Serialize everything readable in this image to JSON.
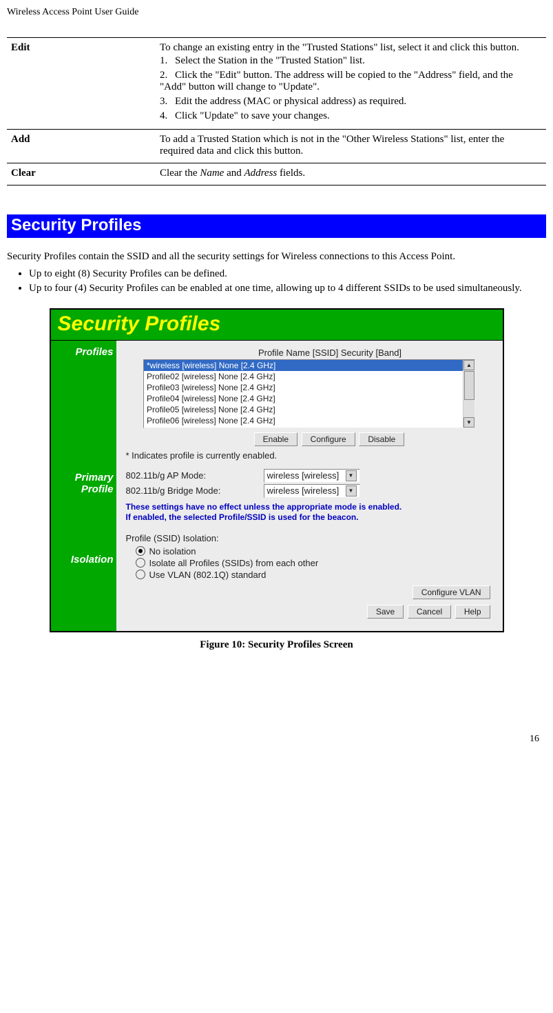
{
  "header": "Wireless Access Point User Guide",
  "pageNumber": "16",
  "table": {
    "rows": [
      {
        "name": "Edit",
        "intro": "To change an existing entry in the \"Trusted Stations\" list, select it and click this button.",
        "steps": [
          "Select the Station in the \"Trusted Station\" list.",
          "Click the \"Edit\" button. The address will be copied to the \"Address\" field, and the \"Add\" button will change to \"Update\".",
          "Edit the address (MAC or physical address) as required.",
          "Click \"Update\" to save your changes."
        ]
      },
      {
        "name": "Add",
        "desc": "To add a Trusted Station which is not in the \"Other Wireless Stations\" list, enter the required data and click this button."
      },
      {
        "name": "Clear",
        "descPrefix": "Clear the ",
        "descItalic1": "Name",
        "descMid": " and ",
        "descItalic2": "Address",
        "descSuffix": " fields."
      }
    ]
  },
  "sectionTitle": "Security Profiles",
  "intro": "Security Profiles contain the SSID and all the security settings for Wireless connections to this Access Point.",
  "bullets": [
    "Up to eight (8) Security Profiles can be defined.",
    "Up to four (4) Security Profiles can be enabled at one time, allowing up to 4 different SSIDs to be used simultaneously."
  ],
  "screenshot": {
    "title": "Security Profiles",
    "side": {
      "profiles": "Profiles",
      "primary1": "Primary",
      "primary2": "Profile",
      "isolation": "Isolation"
    },
    "columnsHeader": "Profile Name [SSID] Security [Band]",
    "list": [
      "*wireless [wireless] None [2.4 GHz]",
      "Profile02 [wireless] None [2.4 GHz]",
      "Profile03 [wireless] None [2.4 GHz]",
      "Profile04 [wireless] None [2.4 GHz]",
      "Profile05 [wireless] None [2.4 GHz]",
      "Profile06 [wireless] None [2.4 GHz]"
    ],
    "buttons": {
      "enable": "Enable",
      "configure": "Configure",
      "disable": "Disable",
      "configureVlan": "Configure VLAN",
      "save": "Save",
      "cancel": "Cancel",
      "help": "Help"
    },
    "note": "* Indicates profile is currently enabled.",
    "primary": {
      "apLabel": "802.11b/g AP Mode:",
      "bridgeLabel": "802.11b/g Bridge Mode:",
      "selectValue": "wireless [wireless]"
    },
    "warning": "These settings have no effect unless the appropriate mode is enabled.\nIf enabled, the selected Profile/SSID is used for the beacon.",
    "isolation": {
      "heading": "Profile (SSID) Isolation:",
      "opt1": "No isolation",
      "opt2": "Isolate all Profiles (SSIDs) from each other",
      "opt3": "Use VLAN (802.1Q) standard"
    }
  },
  "figureCaption": "Figure 10: Security Profiles Screen"
}
